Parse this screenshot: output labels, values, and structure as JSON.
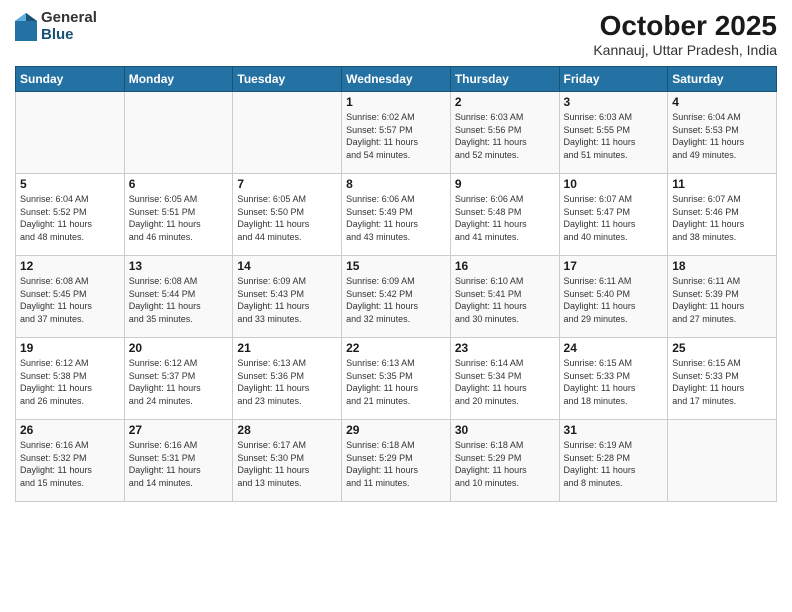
{
  "header": {
    "logo_general": "General",
    "logo_blue": "Blue",
    "month_title": "October 2025",
    "subtitle": "Kannauj, Uttar Pradesh, India"
  },
  "weekdays": [
    "Sunday",
    "Monday",
    "Tuesday",
    "Wednesday",
    "Thursday",
    "Friday",
    "Saturday"
  ],
  "weeks": [
    [
      {
        "day": "",
        "info": ""
      },
      {
        "day": "",
        "info": ""
      },
      {
        "day": "",
        "info": ""
      },
      {
        "day": "1",
        "info": "Sunrise: 6:02 AM\nSunset: 5:57 PM\nDaylight: 11 hours\nand 54 minutes."
      },
      {
        "day": "2",
        "info": "Sunrise: 6:03 AM\nSunset: 5:56 PM\nDaylight: 11 hours\nand 52 minutes."
      },
      {
        "day": "3",
        "info": "Sunrise: 6:03 AM\nSunset: 5:55 PM\nDaylight: 11 hours\nand 51 minutes."
      },
      {
        "day": "4",
        "info": "Sunrise: 6:04 AM\nSunset: 5:53 PM\nDaylight: 11 hours\nand 49 minutes."
      }
    ],
    [
      {
        "day": "5",
        "info": "Sunrise: 6:04 AM\nSunset: 5:52 PM\nDaylight: 11 hours\nand 48 minutes."
      },
      {
        "day": "6",
        "info": "Sunrise: 6:05 AM\nSunset: 5:51 PM\nDaylight: 11 hours\nand 46 minutes."
      },
      {
        "day": "7",
        "info": "Sunrise: 6:05 AM\nSunset: 5:50 PM\nDaylight: 11 hours\nand 44 minutes."
      },
      {
        "day": "8",
        "info": "Sunrise: 6:06 AM\nSunset: 5:49 PM\nDaylight: 11 hours\nand 43 minutes."
      },
      {
        "day": "9",
        "info": "Sunrise: 6:06 AM\nSunset: 5:48 PM\nDaylight: 11 hours\nand 41 minutes."
      },
      {
        "day": "10",
        "info": "Sunrise: 6:07 AM\nSunset: 5:47 PM\nDaylight: 11 hours\nand 40 minutes."
      },
      {
        "day": "11",
        "info": "Sunrise: 6:07 AM\nSunset: 5:46 PM\nDaylight: 11 hours\nand 38 minutes."
      }
    ],
    [
      {
        "day": "12",
        "info": "Sunrise: 6:08 AM\nSunset: 5:45 PM\nDaylight: 11 hours\nand 37 minutes."
      },
      {
        "day": "13",
        "info": "Sunrise: 6:08 AM\nSunset: 5:44 PM\nDaylight: 11 hours\nand 35 minutes."
      },
      {
        "day": "14",
        "info": "Sunrise: 6:09 AM\nSunset: 5:43 PM\nDaylight: 11 hours\nand 33 minutes."
      },
      {
        "day": "15",
        "info": "Sunrise: 6:09 AM\nSunset: 5:42 PM\nDaylight: 11 hours\nand 32 minutes."
      },
      {
        "day": "16",
        "info": "Sunrise: 6:10 AM\nSunset: 5:41 PM\nDaylight: 11 hours\nand 30 minutes."
      },
      {
        "day": "17",
        "info": "Sunrise: 6:11 AM\nSunset: 5:40 PM\nDaylight: 11 hours\nand 29 minutes."
      },
      {
        "day": "18",
        "info": "Sunrise: 6:11 AM\nSunset: 5:39 PM\nDaylight: 11 hours\nand 27 minutes."
      }
    ],
    [
      {
        "day": "19",
        "info": "Sunrise: 6:12 AM\nSunset: 5:38 PM\nDaylight: 11 hours\nand 26 minutes."
      },
      {
        "day": "20",
        "info": "Sunrise: 6:12 AM\nSunset: 5:37 PM\nDaylight: 11 hours\nand 24 minutes."
      },
      {
        "day": "21",
        "info": "Sunrise: 6:13 AM\nSunset: 5:36 PM\nDaylight: 11 hours\nand 23 minutes."
      },
      {
        "day": "22",
        "info": "Sunrise: 6:13 AM\nSunset: 5:35 PM\nDaylight: 11 hours\nand 21 minutes."
      },
      {
        "day": "23",
        "info": "Sunrise: 6:14 AM\nSunset: 5:34 PM\nDaylight: 11 hours\nand 20 minutes."
      },
      {
        "day": "24",
        "info": "Sunrise: 6:15 AM\nSunset: 5:33 PM\nDaylight: 11 hours\nand 18 minutes."
      },
      {
        "day": "25",
        "info": "Sunrise: 6:15 AM\nSunset: 5:33 PM\nDaylight: 11 hours\nand 17 minutes."
      }
    ],
    [
      {
        "day": "26",
        "info": "Sunrise: 6:16 AM\nSunset: 5:32 PM\nDaylight: 11 hours\nand 15 minutes."
      },
      {
        "day": "27",
        "info": "Sunrise: 6:16 AM\nSunset: 5:31 PM\nDaylight: 11 hours\nand 14 minutes."
      },
      {
        "day": "28",
        "info": "Sunrise: 6:17 AM\nSunset: 5:30 PM\nDaylight: 11 hours\nand 13 minutes."
      },
      {
        "day": "29",
        "info": "Sunrise: 6:18 AM\nSunset: 5:29 PM\nDaylight: 11 hours\nand 11 minutes."
      },
      {
        "day": "30",
        "info": "Sunrise: 6:18 AM\nSunset: 5:29 PM\nDaylight: 11 hours\nand 10 minutes."
      },
      {
        "day": "31",
        "info": "Sunrise: 6:19 AM\nSunset: 5:28 PM\nDaylight: 11 hours\nand 8 minutes."
      },
      {
        "day": "",
        "info": ""
      }
    ]
  ]
}
